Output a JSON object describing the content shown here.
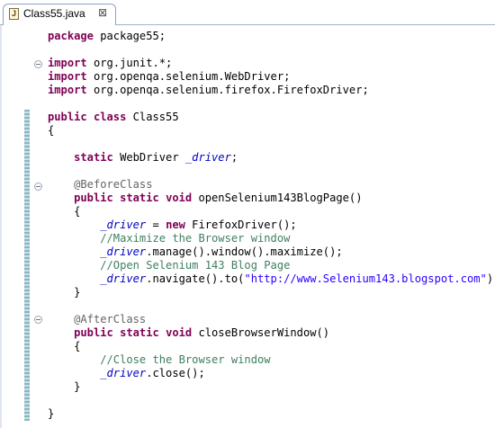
{
  "editor_tab": {
    "title": "Class55.java",
    "file_icon_letter": "J",
    "close_glyph": "⊠"
  },
  "code": {
    "package_kw": "package",
    "package_rest": " package55;",
    "imports": [
      {
        "kw": "import",
        "rest": " org.junit.*;"
      },
      {
        "kw": "import",
        "rest": " org.openqa.selenium.WebDriver;"
      },
      {
        "kw": "import",
        "rest": " org.openqa.selenium.firefox.FirefoxDriver;"
      }
    ],
    "class_kw1": "public",
    "class_kw2": "class",
    "class_name": " Class55",
    "open_brace": "{",
    "close_brace": "}",
    "field_kw": "static",
    "field_type": " WebDriver ",
    "field_name": "_driver",
    "semicolon": ";",
    "before_annotation": "@BeforeClass",
    "method1": {
      "kw1": "public",
      "kw2": "static",
      "kw3": "void",
      "name": " openSelenium143BlogPage()"
    },
    "m1_line1": {
      "field": "_driver",
      "eq": " = ",
      "kw": "new",
      "rest": " FirefoxDriver();"
    },
    "m1_comment1": "//Maximize the Browser window",
    "m1_line2": {
      "field": "_driver",
      "rest": ".manage().window().maximize();"
    },
    "m1_comment2": "//Open Selenium 143 Blog Page",
    "m1_line3": {
      "field": "_driver",
      "pre": ".navigate().to(",
      "string": "\"http://www.Selenium143.blogspot.com\"",
      "post": ");"
    },
    "after_annotation": "@AfterClass",
    "method2": {
      "kw1": "public",
      "kw2": "static",
      "kw3": "void",
      "name": " closeBrowserWindow()"
    },
    "m2_comment": "//Close the Browser window",
    "m2_line1": {
      "field": "_driver",
      "rest": ".close();"
    }
  }
}
